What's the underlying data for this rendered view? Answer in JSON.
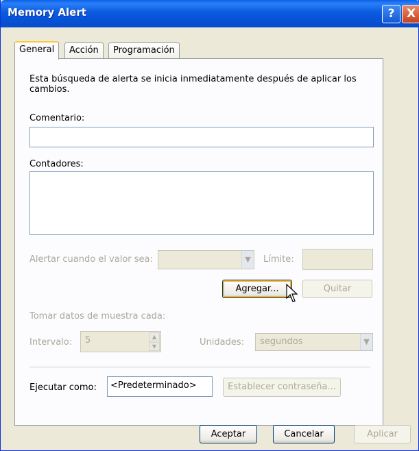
{
  "window": {
    "title": "Memory Alert"
  },
  "titlebar_buttons": {
    "help": "?",
    "close": "X"
  },
  "tabs": [
    {
      "label": "General",
      "active": true
    },
    {
      "label": "Acción",
      "active": false
    },
    {
      "label": "Programación",
      "active": false
    }
  ],
  "general": {
    "description": "Esta búsqueda de alerta se inicia inmediatamente después de aplicar los cambios.",
    "comment_label": "Comentario:",
    "comment_value": "",
    "counters_label": "Contadores:",
    "alert_when_label": "Alertar cuando el valor sea:",
    "alert_when_value": "",
    "limit_label": "Límite:",
    "limit_value": "",
    "add_button": "Agregar...",
    "remove_button": "Quitar",
    "sample_label": "Tomar datos de muestra cada:",
    "interval_label": "Intervalo:",
    "interval_value": "5",
    "units_label": "Unidades:",
    "units_value": "segundos",
    "run_as_label": "Ejecutar como:",
    "run_as_value": "<Predeterminado>",
    "set_password_button": "Establecer contraseña..."
  },
  "footer": {
    "ok_button": "Aceptar",
    "cancel_button": "Cancelar",
    "apply_button": "Aplicar"
  },
  "colors": {
    "titlebar": "#0A5FE8",
    "dialog_bg": "#ECE9D8",
    "focus_ring": "#F8B330"
  },
  "icons": {
    "cursor": "mouse-pointer-icon"
  }
}
